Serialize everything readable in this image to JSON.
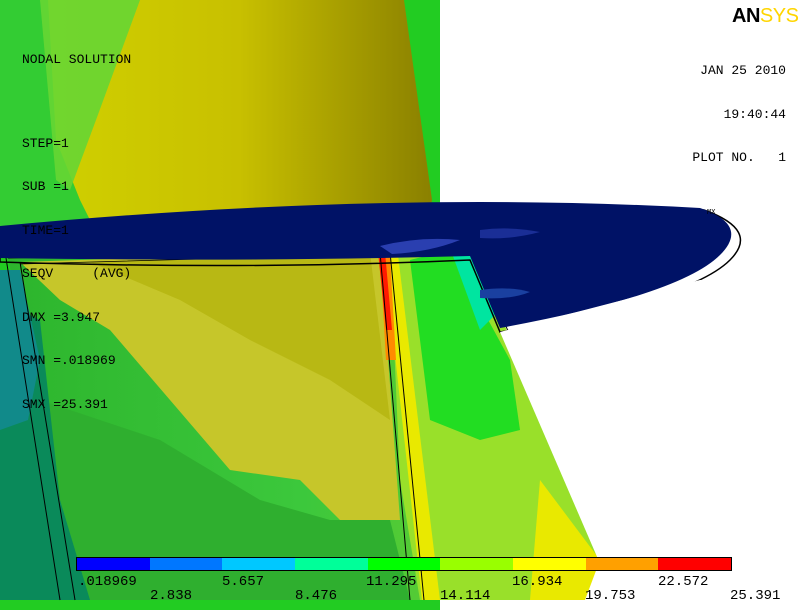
{
  "solution": {
    "title": "NODAL SOLUTION",
    "step": "STEP=1",
    "sub": "SUB =1",
    "time": "TIME=1",
    "seqv": "SEQV     (AVG)",
    "dmx": "DMX =3.947",
    "smn": "SMN =.018969",
    "smx": "SMX =25.391"
  },
  "stamp": {
    "date": "JAN 25 2010",
    "time": "19:40:44",
    "plot": "PLOT NO.   1"
  },
  "logo": {
    "part1": "AN",
    "part2": "SYS"
  },
  "mx_marker": "MX",
  "legend": {
    "colors": [
      "#0000ff",
      "#0077ff",
      "#00c8ff",
      "#00ff99",
      "#00ff00",
      "#99ff00",
      "#ffff00",
      "#ffa000",
      "#ff0000"
    ],
    "labels_top": [
      ".018969",
      "5.657",
      "11.295",
      "16.934",
      "22.572"
    ],
    "labels_bottom": [
      "2.838",
      "8.476",
      "14.114",
      "19.753",
      "25.391"
    ]
  }
}
